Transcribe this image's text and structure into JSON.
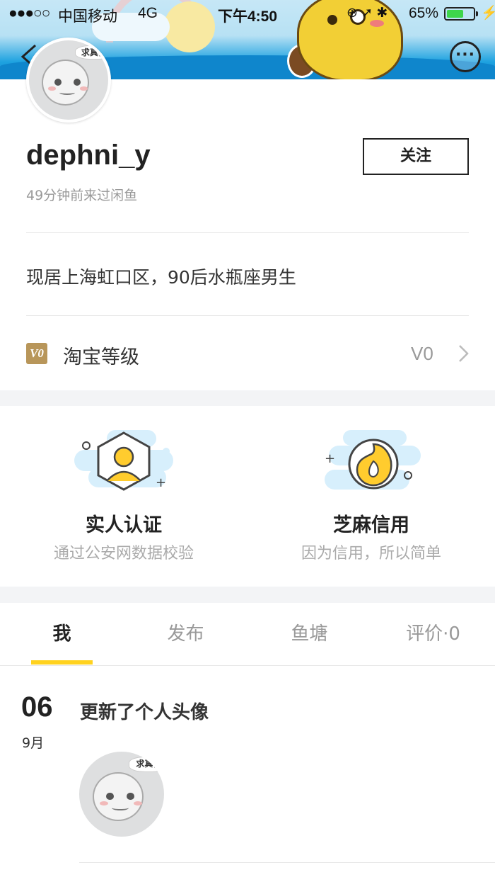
{
  "status_bar": {
    "signal": "●●●○○",
    "carrier": "中国移动",
    "network": "4G",
    "time": "下午4:50",
    "battery_pct": "65%",
    "battery_level": 0.65
  },
  "header": {
    "avatar_bubble_text": "求真像"
  },
  "profile": {
    "username": "dephni_y",
    "last_seen": "49分钟前来过闲鱼",
    "follow_label": "关注",
    "bio": "现居上海虹口区，90后水瓶座男生",
    "level_label": "淘宝等级",
    "level_badge": "V0",
    "level_value": "V0"
  },
  "cards": [
    {
      "title": "实人认证",
      "subtitle": "通过公安网数据校验"
    },
    {
      "title": "芝麻信用",
      "subtitle": "因为信用，所以简单"
    }
  ],
  "tabs": [
    {
      "label": "我",
      "active": true
    },
    {
      "label": "发布",
      "active": false
    },
    {
      "label": "鱼塘",
      "active": false
    },
    {
      "label": "评价·0",
      "active": false
    }
  ],
  "feed": [
    {
      "day": "06",
      "month": "9月",
      "text": "更新了个人头像",
      "image_bubble_text": "求真像"
    }
  ],
  "colors": {
    "accent_yellow": "#ffd21f",
    "badge_gold": "#b8965a",
    "muted_text": "#999999",
    "section_gap": "#f3f4f6"
  }
}
